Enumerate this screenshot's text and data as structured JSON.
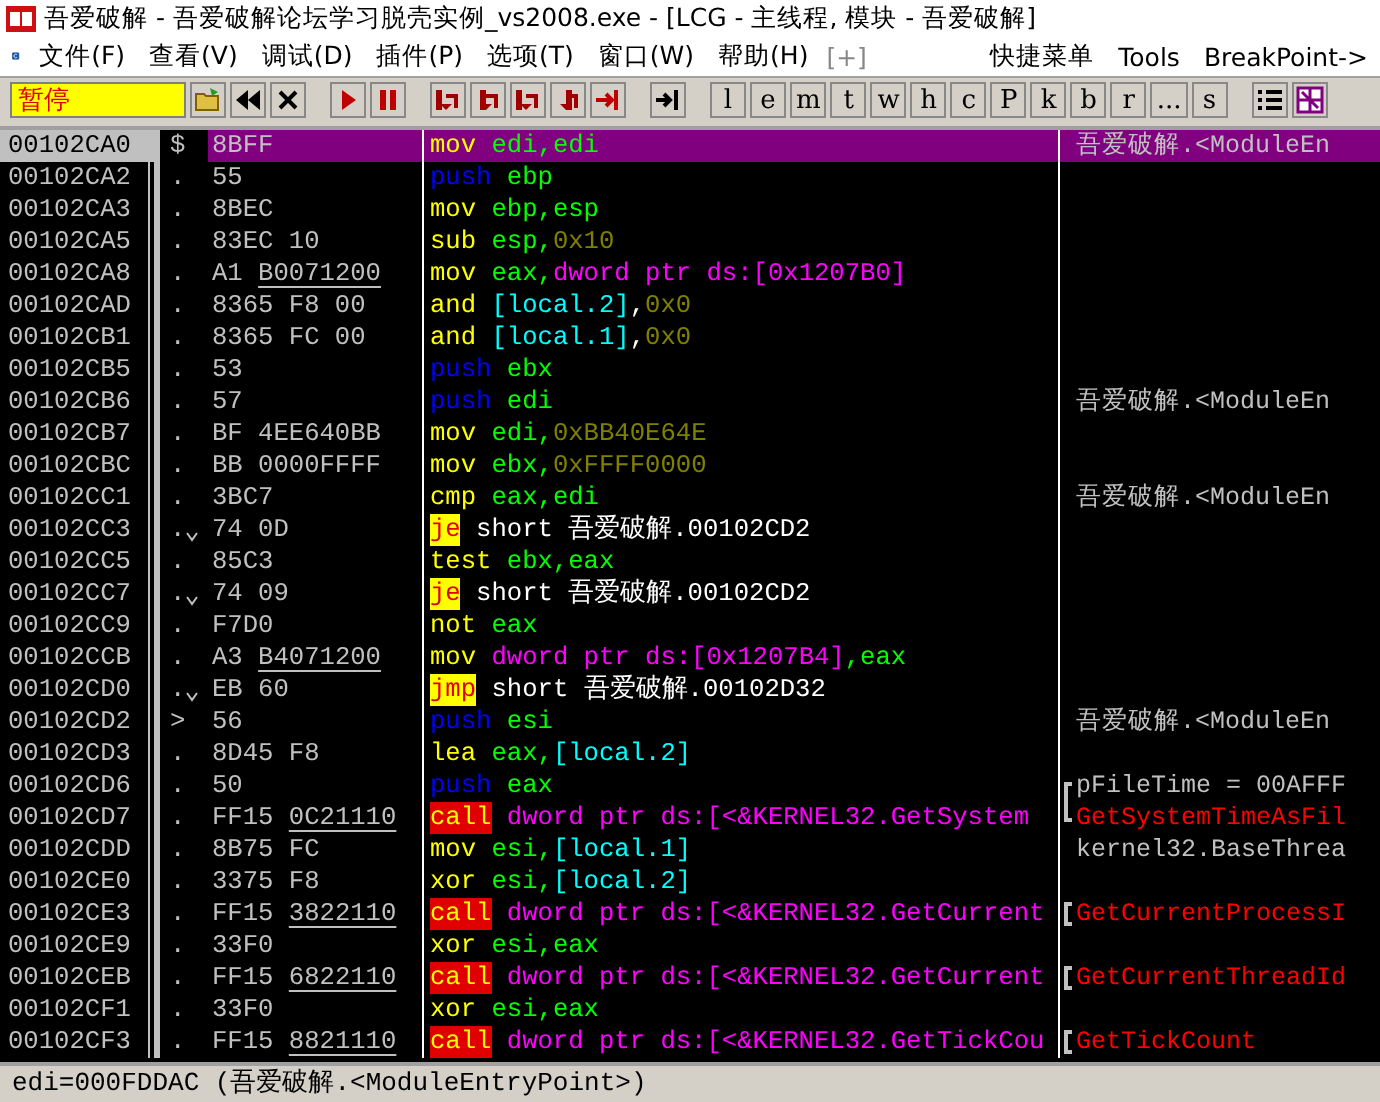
{
  "window": {
    "title": "吾爱破解 - 吾爱破解论坛学习脱壳实例_vs2008.exe - [LCG - 主线程, 模块 - 吾爱破解]"
  },
  "menu": [
    "文件(F)",
    "查看(V)",
    "调试(D)",
    "插件(P)",
    "选项(T)",
    "窗口(W)",
    "帮助(H)"
  ],
  "menu_extra": [
    {
      "label": "[+]",
      "disabled": true
    },
    {
      "label": "快捷菜单",
      "disabled": false
    },
    {
      "label": "Tools",
      "disabled": false
    },
    {
      "label": "BreakPoint->",
      "disabled": false
    }
  ],
  "toolbar": {
    "status": "暂停",
    "window_buttons": [
      "l",
      "e",
      "m",
      "t",
      "w",
      "h",
      "c",
      "P",
      "k",
      "b",
      "r",
      "...",
      "s"
    ]
  },
  "rows": [
    {
      "address": "00102CA0",
      "marker": {
        "text": "$",
        "kind": "entry"
      },
      "hex": "8BFF",
      "mnemonic": {
        "text": "mov",
        "kind": "cmd"
      },
      "operands": [
        {
          "text": " edi,edi",
          "kind": "reg"
        }
      ],
      "comment": {
        "text": "吾爱破解.<ModuleEn",
        "kind": "name"
      },
      "selected": true
    },
    {
      "address": "00102CA2",
      "marker": {
        "text": ".",
        "kind": "dot"
      },
      "hex": "55",
      "mnemonic": {
        "text": "push",
        "kind": "push"
      },
      "operands": [
        {
          "text": " ebp",
          "kind": "reg"
        }
      ],
      "selected": false
    },
    {
      "address": "00102CA3",
      "marker": {
        "text": ".",
        "kind": "dot"
      },
      "hex": "8BEC",
      "mnemonic": {
        "text": "mov",
        "kind": "cmd"
      },
      "operands": [
        {
          "text": " ebp,esp",
          "kind": "reg"
        }
      ],
      "selected": false
    },
    {
      "address": "00102CA5",
      "marker": {
        "text": ".",
        "kind": "dot"
      },
      "hex": "83EC 10",
      "mnemonic": {
        "text": "sub",
        "kind": "cmd"
      },
      "operands": [
        {
          "text": " esp,",
          "kind": "reg"
        },
        {
          "text": "0x10",
          "kind": "const"
        }
      ],
      "selected": false
    },
    {
      "address": "00102CA8",
      "marker": {
        "text": ".",
        "kind": "dot"
      },
      "hex": "A1",
      "hex_fixup": "B0071200",
      "mnemonic": {
        "text": "mov",
        "kind": "cmd"
      },
      "operands": [
        {
          "text": " eax,",
          "kind": "reg"
        },
        {
          "text": "dword ptr ds:[0x1207B0]",
          "kind": "mem"
        }
      ],
      "selected": false
    },
    {
      "address": "00102CAD",
      "marker": {
        "text": ".",
        "kind": "dot"
      },
      "hex": "8365 F8 00",
      "mnemonic": {
        "text": "and",
        "kind": "cmd"
      },
      "operands": [
        {
          "text": " [local.2]",
          "kind": "local"
        },
        {
          "text": ",",
          "kind": "plain"
        },
        {
          "text": "0x0",
          "kind": "const"
        }
      ],
      "selected": false
    },
    {
      "address": "00102CB1",
      "marker": {
        "text": ".",
        "kind": "dot"
      },
      "hex": "8365 FC 00",
      "mnemonic": {
        "text": "and",
        "kind": "cmd"
      },
      "operands": [
        {
          "text": " [local.1]",
          "kind": "local"
        },
        {
          "text": ",",
          "kind": "plain"
        },
        {
          "text": "0x0",
          "kind": "const"
        }
      ],
      "selected": false
    },
    {
      "address": "00102CB5",
      "marker": {
        "text": ".",
        "kind": "dot"
      },
      "hex": "53",
      "mnemonic": {
        "text": "push",
        "kind": "push"
      },
      "operands": [
        {
          "text": " ebx",
          "kind": "reg"
        }
      ],
      "selected": false
    },
    {
      "address": "00102CB6",
      "marker": {
        "text": ".",
        "kind": "dot"
      },
      "hex": "57",
      "mnemonic": {
        "text": "push",
        "kind": "push"
      },
      "operands": [
        {
          "text": " edi",
          "kind": "reg"
        }
      ],
      "comment": {
        "text": "吾爱破解.<ModuleEn",
        "kind": "name"
      },
      "selected": false
    },
    {
      "address": "00102CB7",
      "marker": {
        "text": ".",
        "kind": "dot"
      },
      "hex": "BF 4EE640BB",
      "mnemonic": {
        "text": "mov",
        "kind": "cmd"
      },
      "operands": [
        {
          "text": " edi,",
          "kind": "reg"
        },
        {
          "text": "0xBB40E64E",
          "kind": "const"
        }
      ],
      "selected": false
    },
    {
      "address": "00102CBC",
      "marker": {
        "text": ".",
        "kind": "dot"
      },
      "hex": "BB 0000FFFF",
      "mnemonic": {
        "text": "mov",
        "kind": "cmd"
      },
      "operands": [
        {
          "text": " ebx,",
          "kind": "reg"
        },
        {
          "text": "0xFFFF0000",
          "kind": "const"
        }
      ],
      "selected": false
    },
    {
      "address": "00102CC1",
      "marker": {
        "text": ".",
        "kind": "dot"
      },
      "hex": "3BC7",
      "mnemonic": {
        "text": "cmp",
        "kind": "cmd"
      },
      "operands": [
        {
          "text": " eax,edi",
          "kind": "reg"
        }
      ],
      "comment": {
        "text": "吾爱破解.<ModuleEn",
        "kind": "name"
      },
      "selected": false
    },
    {
      "address": "00102CC3",
      "marker": {
        "text": ".",
        "kind": "jump"
      },
      "hex": "74 0D",
      "mnemonic": {
        "text": "je",
        "kind": "jcc"
      },
      "operands": [
        {
          "text": " short 吾爱破解.00102CD2",
          "kind": "plain"
        }
      ],
      "selected": false
    },
    {
      "address": "00102CC5",
      "marker": {
        "text": ".",
        "kind": "dot"
      },
      "hex": "85C3",
      "mnemonic": {
        "text": "test",
        "kind": "cmd"
      },
      "operands": [
        {
          "text": " ebx,eax",
          "kind": "reg"
        }
      ],
      "selected": false
    },
    {
      "address": "00102CC7",
      "marker": {
        "text": ".",
        "kind": "jump"
      },
      "hex": "74 09",
      "mnemonic": {
        "text": "je",
        "kind": "jcc"
      },
      "operands": [
        {
          "text": " short 吾爱破解.00102CD2",
          "kind": "plain"
        }
      ],
      "selected": false
    },
    {
      "address": "00102CC9",
      "marker": {
        "text": ".",
        "kind": "dot"
      },
      "hex": "F7D0",
      "mnemonic": {
        "text": "not",
        "kind": "cmd"
      },
      "operands": [
        {
          "text": " eax",
          "kind": "reg"
        }
      ],
      "selected": false
    },
    {
      "address": "00102CCB",
      "marker": {
        "text": ".",
        "kind": "dot"
      },
      "hex": "A3",
      "hex_fixup": "B4071200",
      "mnemonic": {
        "text": "mov",
        "kind": "cmd"
      },
      "operands": [
        {
          "text": " dword ptr ds:[0x1207B4]",
          "kind": "mem"
        },
        {
          "text": ",eax",
          "kind": "reg"
        }
      ],
      "selected": false
    },
    {
      "address": "00102CD0",
      "marker": {
        "text": ".",
        "kind": "jump"
      },
      "hex": "EB 60",
      "mnemonic": {
        "text": "jmp",
        "kind": "jcc"
      },
      "operands": [
        {
          "text": " short 吾爱破解.00102D32",
          "kind": "plain"
        }
      ],
      "selected": false
    },
    {
      "address": "00102CD2",
      "marker": {
        "text": ">",
        "kind": "target"
      },
      "hex": "56",
      "mnemonic": {
        "text": "push",
        "kind": "push"
      },
      "operands": [
        {
          "text": " esi",
          "kind": "reg"
        }
      ],
      "comment": {
        "text": "吾爱破解.<ModuleEn",
        "kind": "name"
      },
      "selected": false
    },
    {
      "address": "00102CD3",
      "marker": {
        "text": ".",
        "kind": "dot"
      },
      "hex": "8D45 F8",
      "mnemonic": {
        "text": "lea",
        "kind": "cmd"
      },
      "operands": [
        {
          "text": " eax,",
          "kind": "reg"
        },
        {
          "text": "[local.2]",
          "kind": "local"
        }
      ],
      "selected": false
    },
    {
      "address": "00102CD6",
      "marker": {
        "text": ".",
        "kind": "dot"
      },
      "hex": "50",
      "mnemonic": {
        "text": "push",
        "kind": "push"
      },
      "operands": [
        {
          "text": " eax",
          "kind": "reg"
        }
      ],
      "comment": {
        "text": "pFileTime = 00AFFF",
        "kind": "arg"
      },
      "bracket": {
        "kind": "start"
      },
      "selected": false
    },
    {
      "address": "00102CD7",
      "marker": {
        "text": ".",
        "kind": "dot"
      },
      "hex": "FF15",
      "hex_fixup": "0C21110",
      "mnemonic": {
        "text": "call",
        "kind": "call"
      },
      "operands": [
        {
          "text": " dword ptr ds:[<&KERNEL32.GetSystem",
          "kind": "mem"
        }
      ],
      "comment": {
        "text": "GetSystemTimeAsFil",
        "kind": "api"
      },
      "bracket": {
        "kind": "end"
      },
      "selected": false
    },
    {
      "address": "00102CDD",
      "marker": {
        "text": ".",
        "kind": "dot"
      },
      "hex": "8B75 FC",
      "mnemonic": {
        "text": "mov",
        "kind": "cmd"
      },
      "operands": [
        {
          "text": " esi,",
          "kind": "reg"
        },
        {
          "text": "[local.1]",
          "kind": "local"
        }
      ],
      "comment": {
        "text": "kernel32.BaseThrea",
        "kind": "arg"
      },
      "selected": false
    },
    {
      "address": "00102CE0",
      "marker": {
        "text": ".",
        "kind": "dot"
      },
      "hex": "3375 F8",
      "mnemonic": {
        "text": "xor",
        "kind": "cmd"
      },
      "operands": [
        {
          "text": " esi,",
          "kind": "reg"
        },
        {
          "text": "[local.2]",
          "kind": "local"
        }
      ],
      "selected": false
    },
    {
      "address": "00102CE3",
      "marker": {
        "text": ".",
        "kind": "dot"
      },
      "hex": "FF15",
      "hex_fixup": "3822110",
      "mnemonic": {
        "text": "call",
        "kind": "call"
      },
      "operands": [
        {
          "text": " dword ptr ds:[<&KERNEL32.GetCurrent",
          "kind": "mem"
        }
      ],
      "comment": {
        "text": "GetCurrentProcessI",
        "kind": "api"
      },
      "bracket": {
        "kind": "single"
      },
      "selected": false
    },
    {
      "address": "00102CE9",
      "marker": {
        "text": ".",
        "kind": "dot"
      },
      "hex": "33F0",
      "mnemonic": {
        "text": "xor",
        "kind": "cmd"
      },
      "operands": [
        {
          "text": " esi,eax",
          "kind": "reg"
        }
      ],
      "selected": false
    },
    {
      "address": "00102CEB",
      "marker": {
        "text": ".",
        "kind": "dot"
      },
      "hex": "FF15",
      "hex_fixup": "6822110",
      "mnemonic": {
        "text": "call",
        "kind": "call"
      },
      "operands": [
        {
          "text": " dword ptr ds:[<&KERNEL32.GetCurrent",
          "kind": "mem"
        }
      ],
      "comment": {
        "text": "GetCurrentThreadId",
        "kind": "api"
      },
      "bracket": {
        "kind": "single"
      },
      "selected": false
    },
    {
      "address": "00102CF1",
      "marker": {
        "text": ".",
        "kind": "dot"
      },
      "hex": "33F0",
      "mnemonic": {
        "text": "xor",
        "kind": "cmd"
      },
      "operands": [
        {
          "text": " esi,eax",
          "kind": "reg"
        }
      ],
      "selected": false
    },
    {
      "address": "00102CF3",
      "marker": {
        "text": ".",
        "kind": "dot"
      },
      "hex": "FF15",
      "hex_fixup": "8821110",
      "mnemonic": {
        "text": "call",
        "kind": "call"
      },
      "operands": [
        {
          "text": " dword ptr ds:[<&KERNEL32.GetTickCou",
          "kind": "mem"
        }
      ],
      "comment": {
        "text": "GetTickCount",
        "kind": "api"
      },
      "bracket": {
        "kind": "single"
      },
      "selected": false
    }
  ],
  "status_bar": "edi=000FDDAC (吾爱破解.<ModuleEntryPoint>)"
}
